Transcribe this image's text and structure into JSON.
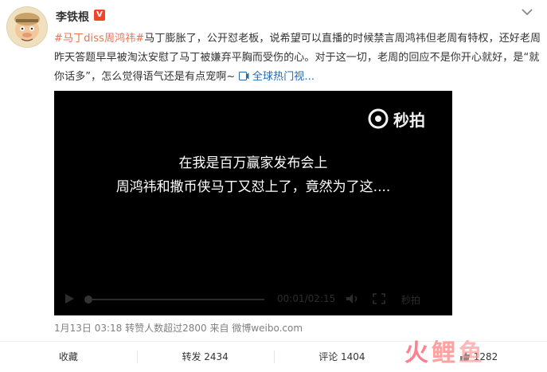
{
  "user": {
    "name": "李铁根",
    "verified_badge": "V"
  },
  "post": {
    "hashtag": "#马丁diss周鸿祎#",
    "text": "马丁膨胀了，公开怼老板，说希望可以直播的时候禁言周鸿祎但老周有特权，还好老周昨天答题早早被淘汰安慰了马丁被嫌弃平胸而受伤的心。对于这一切，老周的回应不是你开心就好，是“就你话多”，怎么觉得语气还是有点宠啊~",
    "video_link": "全球热门视..."
  },
  "video": {
    "logo_text": "秒拍",
    "caption_line1": "在我是百万赢家发布会上",
    "caption_line2": "周鸿祎和撒币侠马丁又怼上了，竟然为了这....",
    "time": "00:01/02:15",
    "brand": "秒拍"
  },
  "meta": {
    "date": "1月13日 03:18",
    "reposts_info": "转赞人数超过2800",
    "source": "来自 微博weibo.com"
  },
  "actions": {
    "favorite": "收藏",
    "repost": "转发 2434",
    "comment": "评论 1404",
    "like": "1282"
  },
  "watermark": {
    "char1": "火",
    "char2": "鲤",
    "char3": "鱼"
  },
  "colors": {
    "hashtag": "#eb7350",
    "link": "#1e6bb8",
    "verified": "#f0442b"
  }
}
